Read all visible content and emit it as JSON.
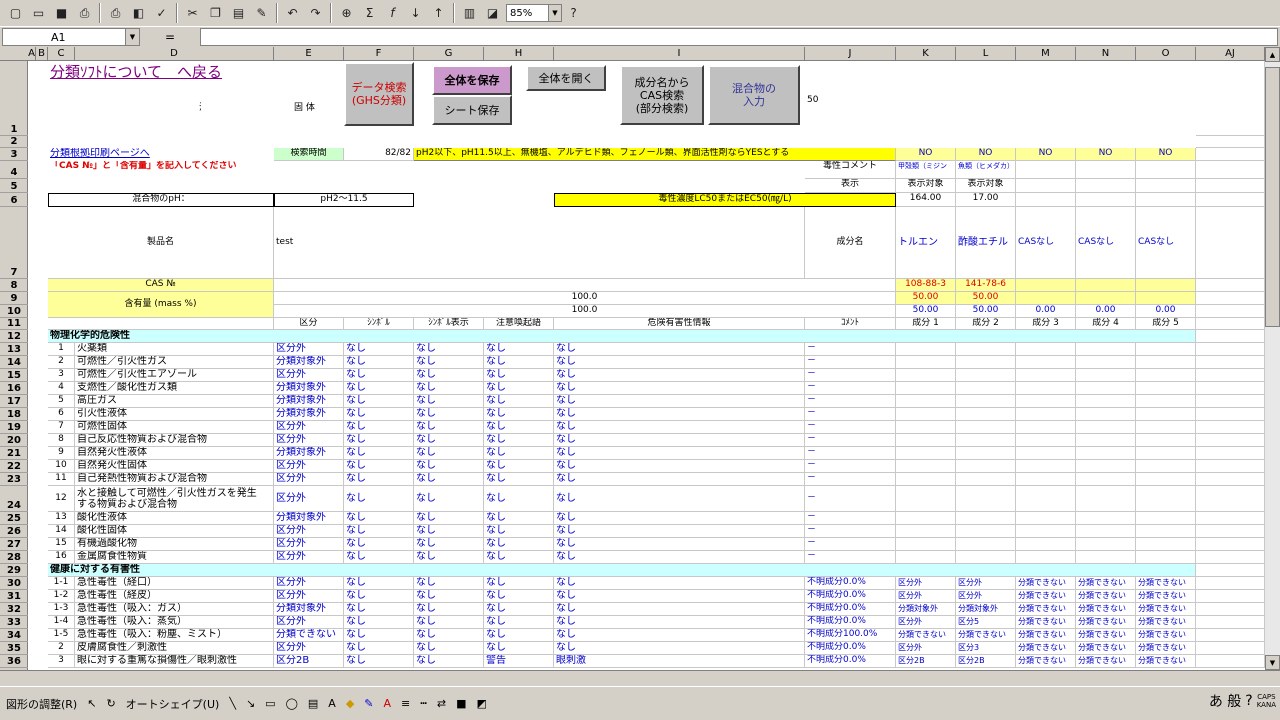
{
  "toolbar": {
    "zoom": "85%"
  },
  "formula_bar": {
    "name_box": "A1",
    "eq": "="
  },
  "columns": [
    "A",
    "B",
    "C",
    "D",
    "E",
    "F",
    "G",
    "H",
    "I",
    "J",
    "K",
    "L",
    "M",
    "N",
    "O",
    "AJ"
  ],
  "rows": [
    "1",
    "2",
    "3",
    "4",
    "5",
    "6",
    "7",
    "8",
    "9",
    "10",
    "11",
    "12",
    "13",
    "14",
    "15",
    "16",
    "17",
    "18",
    "19",
    "20",
    "21",
    "22",
    "23",
    "24",
    "25",
    "26",
    "27",
    "28",
    "29",
    "30",
    "31",
    "32",
    "33",
    "34",
    "35",
    "36"
  ],
  "header": {
    "back_link": "分類ｿﾌﾄについて　へ戻る",
    "property_label": "混合物の性状：",
    "property_value": "固 体",
    "btn_data_search": "データ検索\n(GHS分類)",
    "btn_save_all": "全体を保存",
    "btn_open_all": "全体を開く",
    "btn_save_sheet": "シート保存",
    "btn_cas_search": "成分名から\nCAS検索\n(部分検索)",
    "btn_mixture_input": "混合物の\n入力",
    "value_50": "50",
    "print_link": "分類根拠印刷ページへ",
    "search_time_label": "検索時間",
    "search_time_value": "82/82",
    "notice": "pH2以下、pH11.5以上、無機塩、アルデヒド類、フェノール類、界面活性剤ならYESとする",
    "cas_notice": "「CAS №」と「含有量」を記入してください",
    "toxicity_comment": "毒性コメント",
    "display": "表示",
    "ph_label": "混合物のpH：",
    "ph_value": "pH2～11.5",
    "lc50_label": "毒性濃度LC50またはEC50(㎎/L)",
    "product_name_label": "製品名",
    "product_name": "test",
    "component_name_label": "成分名",
    "cas_label": "CAS №",
    "content_label": "含有量 (mass %)",
    "content_total1": "100.0",
    "content_total2": "100.0"
  },
  "components": [
    {
      "no_flag": "NO",
      "comment": "甲殻類（ミジン",
      "display": "表示対象",
      "lc50": "164.00",
      "name": "トルエン",
      "cas": "108-88-3",
      "content1": "50.00",
      "content2": "50.00",
      "label": "成分 1"
    },
    {
      "no_flag": "NO",
      "comment": "魚類（ヒメダカ）",
      "display": "表示対象",
      "lc50": "17.00",
      "name": "酢酸エチル",
      "cas": "141-78-6",
      "content1": "50.00",
      "content2": "50.00",
      "label": "成分 2"
    },
    {
      "no_flag": "NO",
      "comment": "",
      "display": "",
      "lc50": "",
      "name": "CASなし",
      "cas": "",
      "content1": "",
      "content2": "0.00",
      "label": "成分 3"
    },
    {
      "no_flag": "NO",
      "comment": "",
      "display": "",
      "lc50": "",
      "name": "CASなし",
      "cas": "",
      "content1": "",
      "content2": "0.00",
      "label": "成分 4"
    },
    {
      "no_flag": "NO",
      "comment": "",
      "display": "",
      "lc50": "",
      "name": "CASなし",
      "cas": "",
      "content1": "",
      "content2": "0.00",
      "label": "成分 5"
    }
  ],
  "table_headers": {
    "category": "区分",
    "symbol": "ｼﾝﾎﾞﾙ",
    "symbol_display": "ｼﾝﾎﾞﾙ表示",
    "signal": "注意喚起語",
    "hazard": "危険有害性情報",
    "comment": "ｺﾒﾝﾄ"
  },
  "section_physical": "物理化学的危険性",
  "section_health": "健康に対する有害性",
  "hazard_rows": [
    {
      "num": "1",
      "name": "火薬類",
      "cat": "区分外",
      "sym": "なし",
      "symd": "なし",
      "sig": "なし",
      "haz": "なし",
      "cmt": "－",
      "comps": []
    },
    {
      "num": "2",
      "name": "可燃性／引火性ガス",
      "cat": "分類対象外",
      "sym": "なし",
      "symd": "なし",
      "sig": "なし",
      "haz": "なし",
      "cmt": "－",
      "comps": []
    },
    {
      "num": "3",
      "name": "可燃性／引火性エアゾール",
      "cat": "区分外",
      "sym": "なし",
      "symd": "なし",
      "sig": "なし",
      "haz": "なし",
      "cmt": "－",
      "comps": []
    },
    {
      "num": "4",
      "name": "支燃性／酸化性ガス類",
      "cat": "分類対象外",
      "sym": "なし",
      "symd": "なし",
      "sig": "なし",
      "haz": "なし",
      "cmt": "－",
      "comps": []
    },
    {
      "num": "5",
      "name": "高圧ガス",
      "cat": "分類対象外",
      "sym": "なし",
      "symd": "なし",
      "sig": "なし",
      "haz": "なし",
      "cmt": "－",
      "comps": []
    },
    {
      "num": "6",
      "name": "引火性液体",
      "cat": "分類対象外",
      "sym": "なし",
      "symd": "なし",
      "sig": "なし",
      "haz": "なし",
      "cmt": "－",
      "comps": []
    },
    {
      "num": "7",
      "name": "可燃性固体",
      "cat": "区分外",
      "sym": "なし",
      "symd": "なし",
      "sig": "なし",
      "haz": "なし",
      "cmt": "－",
      "comps": []
    },
    {
      "num": "8",
      "name": "自己反応性物質および混合物",
      "cat": "区分外",
      "sym": "なし",
      "symd": "なし",
      "sig": "なし",
      "haz": "なし",
      "cmt": "－",
      "comps": []
    },
    {
      "num": "9",
      "name": "自然発火性液体",
      "cat": "分類対象外",
      "sym": "なし",
      "symd": "なし",
      "sig": "なし",
      "haz": "なし",
      "cmt": "－",
      "comps": []
    },
    {
      "num": "10",
      "name": "自然発火性固体",
      "cat": "区分外",
      "sym": "なし",
      "symd": "なし",
      "sig": "なし",
      "haz": "なし",
      "cmt": "－",
      "comps": []
    },
    {
      "num": "11",
      "name": "自己発熱性物質および混合物",
      "cat": "区分外",
      "sym": "なし",
      "symd": "なし",
      "sig": "なし",
      "haz": "なし",
      "cmt": "－",
      "comps": []
    },
    {
      "num": "12",
      "name": "水と接触して可燃性／引火性ガスを発生\nする物質および混合物",
      "cat": "区分外",
      "sym": "なし",
      "symd": "なし",
      "sig": "なし",
      "haz": "なし",
      "cmt": "－",
      "comps": []
    },
    {
      "num": "13",
      "name": "酸化性液体",
      "cat": "分類対象外",
      "sym": "なし",
      "symd": "なし",
      "sig": "なし",
      "haz": "なし",
      "cmt": "－",
      "comps": []
    },
    {
      "num": "14",
      "name": "酸化性固体",
      "cat": "区分外",
      "sym": "なし",
      "symd": "なし",
      "sig": "なし",
      "haz": "なし",
      "cmt": "－",
      "comps": []
    },
    {
      "num": "15",
      "name": "有機過酸化物",
      "cat": "区分外",
      "sym": "なし",
      "symd": "なし",
      "sig": "なし",
      "haz": "なし",
      "cmt": "－",
      "comps": []
    },
    {
      "num": "16",
      "name": "金属腐食性物質",
      "cat": "区分外",
      "sym": "なし",
      "symd": "なし",
      "sig": "なし",
      "haz": "なし",
      "cmt": "－",
      "comps": []
    }
  ],
  "health_rows": [
    {
      "num": "1-1",
      "name": "急性毒性（経口）",
      "cat": "区分外",
      "sym": "なし",
      "symd": "なし",
      "sig": "なし",
      "haz": "なし",
      "cmt": "不明成分0.0%",
      "comps": [
        "区分外",
        "区分外",
        "分類できない",
        "分類できない",
        "分類できない"
      ]
    },
    {
      "num": "1-2",
      "name": "急性毒性（経皮）",
      "cat": "区分外",
      "sym": "なし",
      "symd": "なし",
      "sig": "なし",
      "haz": "なし",
      "cmt": "不明成分0.0%",
      "comps": [
        "区分外",
        "区分外",
        "分類できない",
        "分類できない",
        "分類できない"
      ]
    },
    {
      "num": "1-3",
      "name": "急性毒性（吸入：ガス）",
      "cat": "分類対象外",
      "sym": "なし",
      "symd": "なし",
      "sig": "なし",
      "haz": "なし",
      "cmt": "不明成分0.0%",
      "comps": [
        "分類対象外",
        "分類対象外",
        "分類できない",
        "分類できない",
        "分類できない"
      ]
    },
    {
      "num": "1-4",
      "name": "急性毒性（吸入：蒸気）",
      "cat": "区分外",
      "sym": "なし",
      "symd": "なし",
      "sig": "なし",
      "haz": "なし",
      "cmt": "不明成分0.0%",
      "comps": [
        "区分外",
        "区分5",
        "分類できない",
        "分類できない",
        "分類できない"
      ]
    },
    {
      "num": "1-5",
      "name": "急性毒性（吸入：粉塵、ミスト）",
      "cat": "分類できない",
      "sym": "なし",
      "symd": "なし",
      "sig": "なし",
      "haz": "なし",
      "cmt": "不明成分100.0%",
      "comps": [
        "分類できない",
        "分類できない",
        "分類できない",
        "分類できない",
        "分類できない"
      ]
    },
    {
      "num": "2",
      "name": "皮膚腐食性／刺激性",
      "cat": "区分外",
      "sym": "なし",
      "symd": "なし",
      "sig": "なし",
      "haz": "なし",
      "cmt": "不明成分0.0%",
      "comps": [
        "区分外",
        "区分3",
        "分類できない",
        "分類できない",
        "分類できない"
      ]
    },
    {
      "num": "3",
      "name": "眼に対する重篤な損傷性／眼刺激性",
      "cat": "区分2B",
      "sym": "なし",
      "symd": "なし",
      "sig": "警告",
      "haz": "眼刺激",
      "cmt": "不明成分0.0%",
      "comps": [
        "区分2B",
        "区分2B",
        "分類できない",
        "分類できない",
        "分類できない"
      ]
    }
  ],
  "drawbar": {
    "adjust": "図形の調整(R)",
    "autoshape": "オートシェイプ(U)",
    "ime": "あ 般",
    "caps": "CAPS\nKANA"
  }
}
